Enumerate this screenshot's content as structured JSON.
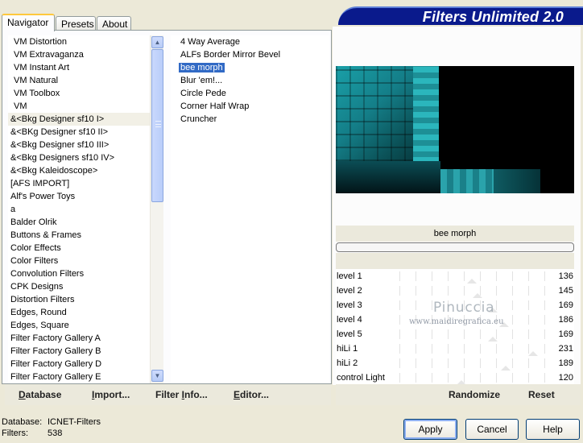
{
  "tabs": [
    {
      "label": "Navigator",
      "active": true
    },
    {
      "label": "Presets",
      "active": false
    },
    {
      "label": "About",
      "active": false
    }
  ],
  "categories": [
    "VM Distortion",
    "VM Extravaganza",
    "VM Instant Art",
    "VM Natural",
    "VM Toolbox",
    "VM",
    "&<Bkg Designer sf10 I>",
    "&<BKg Designer sf10 II>",
    "&<Bkg Designer sf10 III>",
    "&<Bkg Designers sf10 IV>",
    "&<Bkg Kaleidoscope>",
    "[AFS IMPORT]",
    "Alf's Power Toys",
    "a",
    "Balder Olrik",
    "Buttons & Frames",
    "Color Effects",
    "Color Filters",
    "Convolution Filters",
    "CPK Designs",
    "Distortion Filters",
    "Edges, Round",
    "Edges, Square",
    "Filter Factory Gallery A",
    "Filter Factory Gallery B",
    "Filter Factory Gallery D",
    "Filter Factory Gallery E"
  ],
  "selected_category_index": 6,
  "filters": [
    "4 Way Average",
    "ALFs Border Mirror Bevel",
    "bee morph",
    "Blur 'em!...",
    "Circle Pede",
    "Corner Half Wrap",
    "Cruncher"
  ],
  "selected_filter_index": 2,
  "left_buttons": {
    "database": {
      "u": "D",
      "rest": "atabase"
    },
    "import": {
      "u": "I",
      "rest": "mport..."
    },
    "filter_info": {
      "pre": "Filter ",
      "u": "I",
      "rest": "nfo..."
    },
    "editor": {
      "u": "E",
      "rest": "ditor..."
    }
  },
  "header_title": "Filters Unlimited 2.0",
  "current_filter_name": "bee morph",
  "sliders": [
    {
      "label": "level 1",
      "value": "136",
      "level": 136
    },
    {
      "label": "level 2",
      "value": "145",
      "level": 145
    },
    {
      "label": "level 3",
      "value": "169",
      "level": 169
    },
    {
      "label": "level 4",
      "value": "186",
      "level": 186
    },
    {
      "label": "level 5",
      "value": "169",
      "level": 169
    },
    {
      "label": "hiLi 1",
      "value": "231",
      "level": 231
    },
    {
      "label": "hiLi 2",
      "value": "189",
      "level": 189
    },
    {
      "label": "control Light",
      "value": "120",
      "level": 120
    }
  ],
  "watermark": {
    "line1": "Pinuccia",
    "line2": "www.maidiregrafica.eu"
  },
  "right_buttons": {
    "randomize": "Randomize",
    "reset": "Reset"
  },
  "footer": {
    "database_label": "Database:",
    "database_value": "ICNET-Filters",
    "filters_label": "Filters:",
    "filters_value": "538"
  },
  "dialog_buttons": {
    "apply": "Apply",
    "cancel": "Cancel",
    "help": "Help"
  },
  "colors": {
    "banner": "#0a1a8c",
    "selection": "#316ac5",
    "preview_teal": "#1aa0a8"
  }
}
